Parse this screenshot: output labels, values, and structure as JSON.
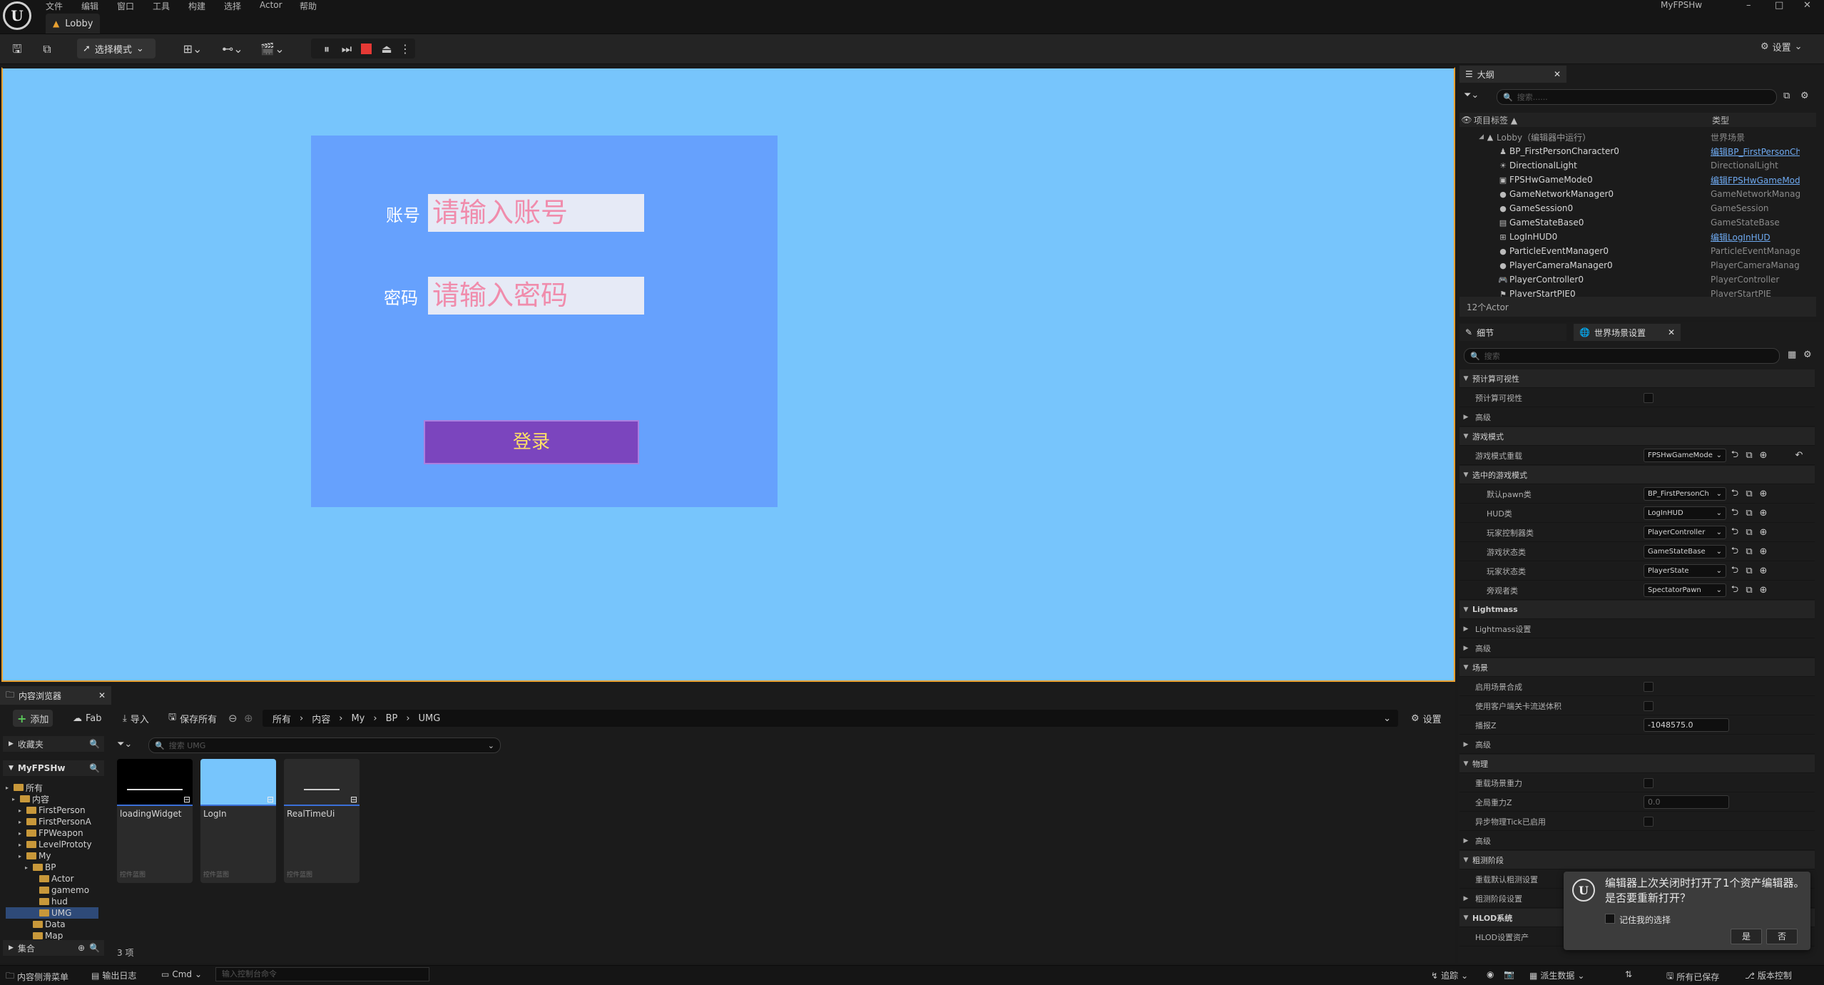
{
  "window": {
    "menu": [
      "文件",
      "编辑",
      "窗口",
      "工具",
      "构建",
      "选择",
      "Actor",
      "帮助"
    ],
    "level_tab": "Lobby",
    "project_name": "MyFPSHw",
    "controls": [
      "–",
      "□",
      "✕"
    ]
  },
  "toolbar": {
    "mode_label": "选择模式",
    "settings_label": "设置"
  },
  "viewport": {
    "account_label": "账号",
    "account_placeholder": "请输入账号",
    "password_label": "密码",
    "password_placeholder": "请输入密码",
    "login_button": "登录",
    "colors": {
      "background": "#77c5fc",
      "panel": "#66a1fd",
      "button": "#7b45be",
      "button_text": "#ffe066",
      "placeholder": "#f08cac"
    }
  },
  "outliner": {
    "tab_label": "大纲",
    "search_placeholder": "搜索......",
    "col_label": "项目标签 ▲",
    "col_type": "类型",
    "root": {
      "name": "Lobby（编辑器中运行）",
      "type": "世界场景"
    },
    "rows": [
      {
        "icon": "pawn-icon",
        "name": "BP_FirstPersonCharacter0",
        "type": "编辑BP_FirstPersonCh",
        "link": true
      },
      {
        "icon": "light-icon",
        "name": "DirectionalLight",
        "type": "DirectionalLight",
        "link": false
      },
      {
        "icon": "gamemode-icon",
        "name": "FPSHwGameMode0",
        "type": "编辑FPSHwGameMode",
        "link": true
      },
      {
        "icon": "actor-icon",
        "name": "GameNetworkManager0",
        "type": "GameNetworkManager",
        "link": false
      },
      {
        "icon": "actor-icon",
        "name": "GameSession0",
        "type": "GameSession",
        "link": false
      },
      {
        "icon": "gamestate-icon",
        "name": "GameStateBase0",
        "type": "GameStateBase",
        "link": false
      },
      {
        "icon": "hud-icon",
        "name": "LogInHUD0",
        "type": "编辑LogInHUD",
        "link": true
      },
      {
        "icon": "actor-icon",
        "name": "ParticleEventManager0",
        "type": "ParticleEventManager",
        "link": false
      },
      {
        "icon": "actor-icon",
        "name": "PlayerCameraManager0",
        "type": "PlayerCameraManager",
        "link": false
      },
      {
        "icon": "controller-icon",
        "name": "PlayerController0",
        "type": "PlayerController",
        "link": false
      },
      {
        "icon": "playerstart-icon",
        "name": "PlayerStartPIE0",
        "type": "PlayerStartPIE",
        "link": false
      }
    ],
    "count": "12个Actor"
  },
  "details": {
    "tab_details": "细节",
    "tab_world": "世界场景设置",
    "search_placeholder": "搜索",
    "rows": [
      {
        "kind": "cat",
        "label": "预计算可视性"
      },
      {
        "kind": "check",
        "label": "预计算可视性"
      },
      {
        "kind": "sub",
        "label": "高级"
      },
      {
        "kind": "cat",
        "label": "游戏模式"
      },
      {
        "kind": "combo",
        "label": "游戏模式重载",
        "value": "FPSHwGameMode"
      },
      {
        "kind": "cat2",
        "label": "选中的游戏模式"
      },
      {
        "kind": "combo2",
        "label": "默认pawn类",
        "value": "BP_FirstPersonCh"
      },
      {
        "kind": "combo2",
        "label": "HUD类",
        "value": "LogInHUD"
      },
      {
        "kind": "combo2",
        "label": "玩家控制器类",
        "value": "PlayerController"
      },
      {
        "kind": "combo2",
        "label": "游戏状态类",
        "value": "GameStateBase"
      },
      {
        "kind": "combo2",
        "label": "玩家状态类",
        "value": "PlayerState"
      },
      {
        "kind": "combo2",
        "label": "旁观者类",
        "value": "SpectatorPawn"
      },
      {
        "kind": "cat",
        "label": "Lightmass"
      },
      {
        "kind": "sub",
        "label": "Lightmass设置"
      },
      {
        "kind": "sub",
        "label": "高级"
      },
      {
        "kind": "cat",
        "label": "场景"
      },
      {
        "kind": "check",
        "label": "启用场景合成"
      },
      {
        "kind": "check",
        "label": "使用客户端关卡流送体积"
      },
      {
        "kind": "num",
        "label": "播报Z",
        "value": "-1048575.0"
      },
      {
        "kind": "sub",
        "label": "高级"
      },
      {
        "kind": "cat",
        "label": "物理"
      },
      {
        "kind": "check",
        "label": "重载场景重力"
      },
      {
        "kind": "num_dim",
        "label": "全局重力Z",
        "value": "0.0"
      },
      {
        "kind": "check",
        "label": "异步物理Tick已启用"
      },
      {
        "kind": "sub",
        "label": "高级"
      },
      {
        "kind": "cat",
        "label": "粗测阶段"
      },
      {
        "kind": "check",
        "label": "重载默认粗测设置"
      },
      {
        "kind": "sub",
        "label": "粗测阶段设置"
      },
      {
        "kind": "cat",
        "label": "HLOD系统"
      },
      {
        "kind": "plain",
        "label": "HLOD设置资产"
      }
    ]
  },
  "content_browser": {
    "tab_label": "内容浏览器",
    "add_label": "添加",
    "fab_label": "Fab",
    "import_label": "导入",
    "save_all_label": "保存所有",
    "path": [
      "所有",
      "内容",
      "My",
      "BP",
      "UMG"
    ],
    "settings_label": "设置",
    "favorites_label": "收藏夹",
    "project_label": "MyFPSHw",
    "search_placeholder": "搜索 UMG",
    "tree": [
      {
        "indent": 0,
        "name": "所有"
      },
      {
        "indent": 1,
        "name": "内容"
      },
      {
        "indent": 2,
        "name": "FirstPerson"
      },
      {
        "indent": 2,
        "name": "FirstPersonA"
      },
      {
        "indent": 2,
        "name": "FPWeapon"
      },
      {
        "indent": 2,
        "name": "LevelPrototy"
      },
      {
        "indent": 2,
        "name": "My"
      },
      {
        "indent": 3,
        "name": "BP"
      },
      {
        "indent": 4,
        "name": "Actor"
      },
      {
        "indent": 4,
        "name": "gamemo"
      },
      {
        "indent": 4,
        "name": "hud"
      },
      {
        "indent": 4,
        "name": "UMG"
      },
      {
        "indent": 3,
        "name": "Data"
      },
      {
        "indent": 3,
        "name": "Map"
      }
    ],
    "collections_label": "集合",
    "assets": [
      {
        "name": "loadingWidget",
        "type": "控件蓝图",
        "thumb": "#000000"
      },
      {
        "name": "LogIn",
        "type": "控件蓝图",
        "thumb": "#77c5fc"
      },
      {
        "name": "RealTimeUi",
        "type": "控件蓝图",
        "thumb": "#2b2b2b"
      }
    ],
    "item_count": "3 项"
  },
  "statusbar": {
    "drawer": "内容侧滑菜单",
    "output_log": "输出日志",
    "cmd": "Cmd",
    "console_placeholder": "输入控制台命令",
    "trace": "追踪",
    "derived_data": "派生数据",
    "all_saved": "所有已保存",
    "version_control": "版本控制"
  },
  "notification": {
    "message": "编辑器上次关闭时打开了1个资产编辑器。是否要重新打开？",
    "remember": "记住我的选择",
    "yes": "是",
    "no": "否"
  }
}
